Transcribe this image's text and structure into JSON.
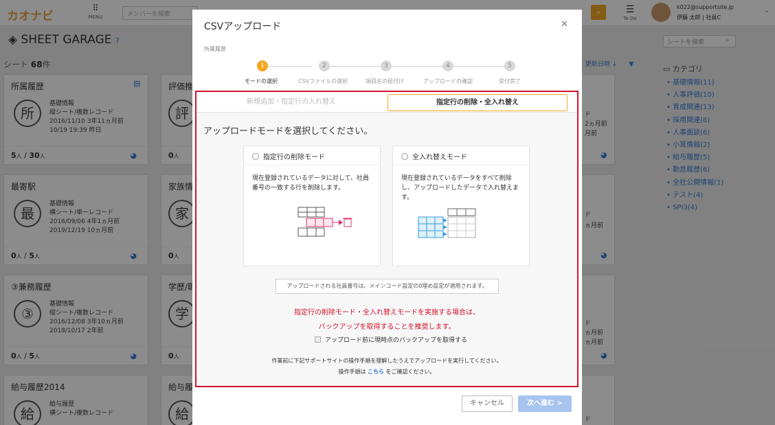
{
  "app": {
    "logo_text": "カオナビ",
    "menu_label": "MENU",
    "member_search_placeholder": "メンバーを検索",
    "todo_label": "To Do",
    "user_email": "k022@supportsite.jp",
    "user_name": "伊藤 太郎 | 社員C"
  },
  "page": {
    "title": "SHEET GARAGE",
    "sheet_count_prefix": "シート",
    "sheet_count_value": "68",
    "sheet_count_suffix": "件"
  },
  "cards": [
    {
      "title": "所属履歴",
      "initial": "所",
      "lines": [
        "基礎情報",
        "縦シート/複数レコード",
        "2016/11/10 3年11ヵ月前",
        "10/19 19:39 昨日"
      ],
      "footer_a": "5",
      "footer_b": "30",
      "menu_label": "メニュー"
    },
    {
      "title": "最寄駅",
      "initial": "最",
      "lines": [
        "基礎情報",
        "横シート/単一レコード",
        "2016/09/06 4年1ヵ月前",
        "2019/12/19 10ヵ月前"
      ],
      "footer_a": "0",
      "footer_b": "5"
    },
    {
      "title": "③兼務履歴",
      "initial": "③",
      "lines": [
        "基礎情報",
        "縦シート/複数レコード",
        "2016/12/08 3年10ヵ月前",
        "2018/10/17 2年前"
      ],
      "footer_a": "0",
      "footer_b": "5"
    },
    {
      "title": "給与履歴2014",
      "initial": "給",
      "lines": [
        "給与履歴",
        "横シート/複数レコード"
      ],
      "footer_a": "",
      "footer_b": ""
    }
  ],
  "cards_col2": [
    {
      "title": "評価推",
      "initial": "評",
      "footer": "0"
    },
    {
      "title": "家族情",
      "initial": "家",
      "footer": "0"
    },
    {
      "title": "学歴/職",
      "initial": "学",
      "footer": "0"
    },
    {
      "title": "給与履",
      "initial": "給",
      "footer": ""
    }
  ],
  "unit_person": "人",
  "right_panel": {
    "search_placeholder": "シートを検索",
    "sort_label": "更新日時",
    "category_heading": "カテゴリ",
    "categories": [
      "基礎情報(11)",
      "人事評価(10)",
      "育成関連(13)",
      "採用関連(6)",
      "人事面談(6)",
      "小耳情報(2)",
      "給与履歴(5)",
      "勤怠履歴(6)",
      "全社公開情報(1)",
      "テスト(4)",
      "SPI3(4)"
    ]
  },
  "partial_right": {
    "texts": [
      "ド",
      "2ヵ月前",
      "月前",
      "ド",
      "ヵ月前",
      "ド",
      "ヵ月前",
      "ヵ月前",
      "ド"
    ]
  },
  "modal": {
    "title": "CSVアップロード",
    "subtitle": "所属履歴",
    "steps": [
      {
        "num": "1",
        "label": "モードの選択"
      },
      {
        "num": "2",
        "label": "CSVファイルの選択"
      },
      {
        "num": "3",
        "label": "項目名の紐付け"
      },
      {
        "num": "4",
        "label": "アップロードの確認"
      },
      {
        "num": "5",
        "label": "受付完了"
      }
    ],
    "tab_inactive": "新規追加・指定行の入れ替え",
    "tab_active": "指定行の削除・全入れ替え",
    "question": "アップロードモードを選択してください。",
    "option_delete": {
      "title": "指定行の削除モード",
      "desc": "現在登録されているデータに対して、社員番号の一致する行を削除します。"
    },
    "option_replace": {
      "title": "全入れ替えモード",
      "desc": "現在登録されているデータをすべて削除し、アップロードしたデータで入れ替えます。"
    },
    "note": "アップロードされる社員番号は、メインコード設定の0埋め設定が適用されます。",
    "warning_line1": "指定行の削除モード・全入れ替えモードを実施する場合は、",
    "warning_line2": "バックアップを取得することを推奨します。",
    "backup_checkbox": "アップロード前に現時点のバックアップを取得する",
    "footer_line1": "作業前に下記サポートサイトの操作手順を理解したうえでアップロードを実行してください。",
    "footer_line2_pre": "操作手順は",
    "footer_link": "こちら",
    "footer_line2_post": "をご確認ください。",
    "cancel_label": "キャンセル",
    "next_label": "次へ進む >"
  },
  "colors": {
    "accent": "#f5a623",
    "danger": "#d0142c",
    "link": "#3a7bd5"
  }
}
